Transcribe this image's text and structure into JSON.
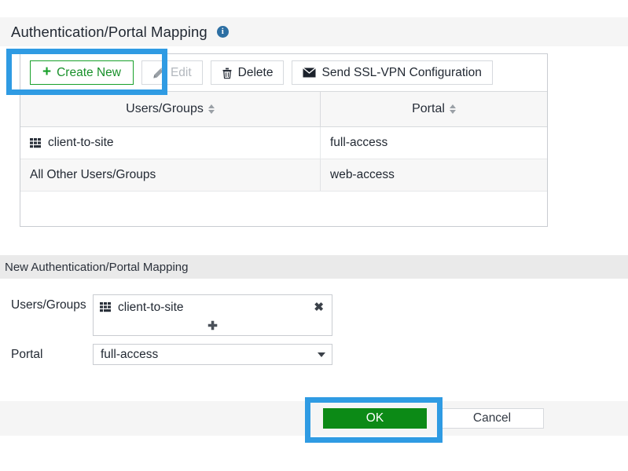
{
  "header": {
    "title": "Authentication/Portal Mapping",
    "info_icon": "info-icon",
    "info_glyph": "i"
  },
  "toolbar": {
    "create_new_label": "Create New",
    "create_new_icon": "plus-icon",
    "create_new_glyph": "+",
    "edit_label": "Edit",
    "edit_icon": "pencil-icon",
    "edit_enabled": false,
    "delete_label": "Delete",
    "delete_icon": "trash-icon",
    "send_config_label": "Send SSL-VPN Configuration",
    "send_config_icon": "envelope-icon"
  },
  "table": {
    "columns": [
      {
        "label": "Users/Groups",
        "sortable": true
      },
      {
        "label": "Portal",
        "sortable": true
      }
    ],
    "rows": [
      {
        "users_groups": "client-to-site",
        "icon": "user-group-icon",
        "portal": "full-access"
      },
      {
        "users_groups": "All Other Users/Groups",
        "icon": null,
        "portal": "web-access"
      }
    ]
  },
  "new_mapping": {
    "section_title": "New Authentication/Portal Mapping",
    "users_groups_label": "Users/Groups",
    "users_groups_chip": "client-to-site",
    "users_groups_chip_icon": "user-group-icon",
    "chip_remove_glyph": "✖",
    "chip_add_glyph": "✚",
    "portal_label": "Portal",
    "portal_value": "full-access"
  },
  "footer": {
    "ok_label": "OK",
    "cancel_label": "Cancel"
  },
  "colors": {
    "accent_blue": "#2f9be3",
    "green": "#0c8a16",
    "green_outline": "#18a02a",
    "info_blue": "#2d6fa3",
    "band_gray": "#f5f5f5",
    "subsection_gray": "#eaeaea",
    "border_gray": "#c9ccd1",
    "disabled_text": "#b3b8be"
  }
}
